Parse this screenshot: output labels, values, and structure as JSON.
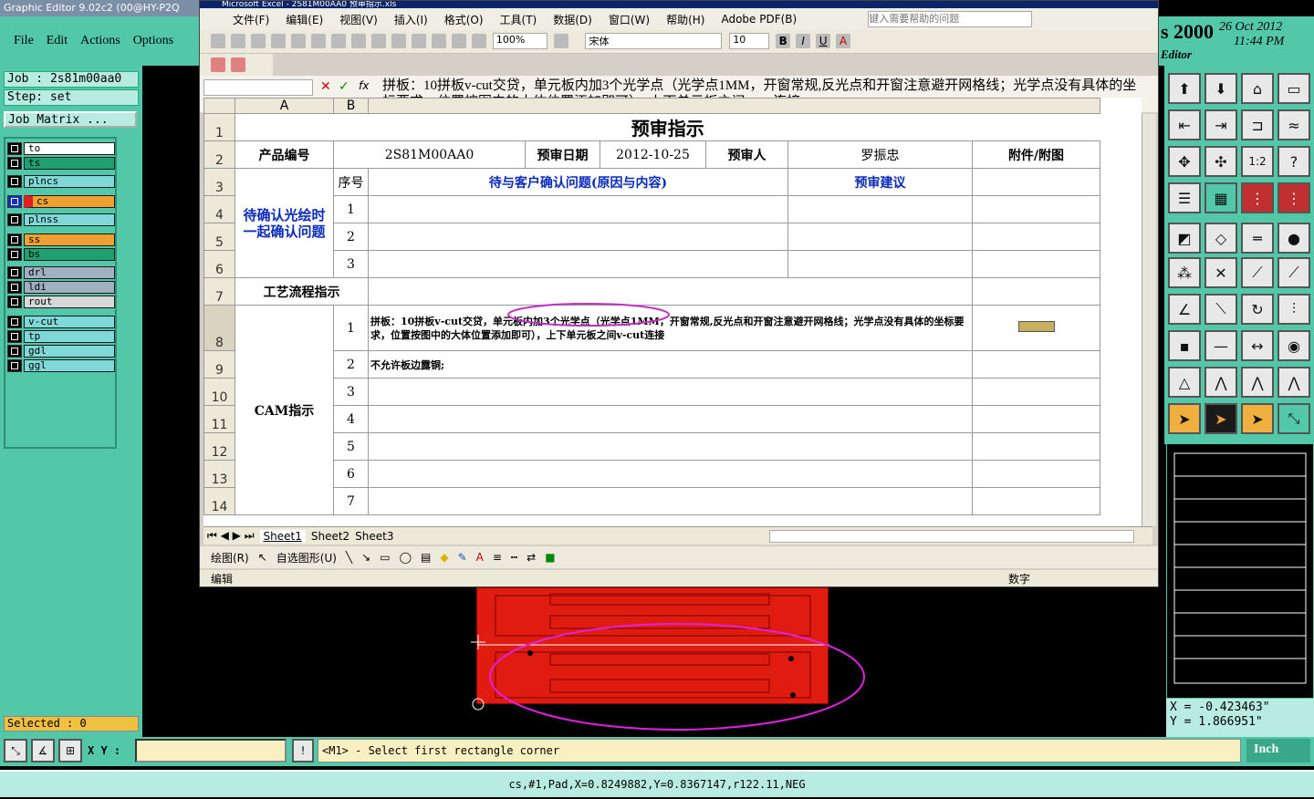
{
  "genesis": {
    "title": "Graphic Editor 9.02c2 (00@HY-P2Q",
    "menu": [
      "File",
      "Edit",
      "Actions",
      "Options"
    ],
    "job": "Job : 2s81m00aa0",
    "step": "Step: set",
    "job_matrix": "Job Matrix ...",
    "layers": [
      {
        "name": "to",
        "color": "#ffffff"
      },
      {
        "name": "ts",
        "color": "#20a070"
      },
      {
        "name": "plncs",
        "color": "#80d8d8"
      },
      {
        "name": "cs",
        "color": "#f0a030"
      },
      {
        "name": "plnss",
        "color": "#80d8d8"
      },
      {
        "name": "ss",
        "color": "#f0a030"
      },
      {
        "name": "bs",
        "color": "#20a070"
      },
      {
        "name": "drl",
        "color": "#a0b0c0"
      },
      {
        "name": "ldi",
        "color": "#a0b0c0"
      },
      {
        "name": "rout",
        "color": "#d8d8d8"
      },
      {
        "name": "v-cut",
        "color": "#80d8d8"
      },
      {
        "name": "tp",
        "color": "#80d8d8"
      },
      {
        "name": "gdl",
        "color": "#80d8d8"
      },
      {
        "name": "ggl",
        "color": "#80d8d8"
      }
    ],
    "selected": "Selected : 0",
    "clock_year": "s 2000",
    "clock_date": "26 Oct 2012",
    "clock_time": "11:44 PM",
    "clock_label": "Editor",
    "coord_x": "X = -0.423463\"",
    "coord_y": "Y = 1.866951\"",
    "xy_label": "X Y :",
    "prompt": "<M1> - Select first rectangle corner",
    "units": "Inch",
    "status": "cs,#1,Pad,X=0.8249882,Y=0.8367147,r122.11,NEG"
  },
  "excel": {
    "title": "Microsoft Excel - 2S81M00AA0 预审指示.xls",
    "menu": [
      "文件(F)",
      "编辑(E)",
      "视图(V)",
      "插入(I)",
      "格式(O)",
      "工具(T)",
      "数据(D)",
      "窗口(W)",
      "帮助(H)",
      "Adobe PDF(B)"
    ],
    "help_placeholder": "键入需要帮助的问题",
    "zoom": "100%",
    "font_name": "宋体",
    "font_size": "10",
    "formula_text": "拼板：10拼板v-cut交贷，单元板内加3个光学点（光学点1MM，开窗常规,反光点和开窗注意避开网格线；光学点没有具体的坐标要求，位置按图中的大体位置添加即可），上下单元板之间v-cut连接",
    "col_a": "A",
    "col_b": "B",
    "sheet_title": "预审指示",
    "product_label": "产品编号",
    "product_no": "2S81M00AA0",
    "date_label": "预审日期",
    "date": "2012-10-25",
    "reviewer_label": "预审人",
    "reviewer": "罗振忠",
    "attach_label": "附件/附图",
    "confirm_label": "待确认光绘时一起确认问题",
    "seq_label": "序号",
    "issue_label": "待与客户确认问题(原因与内容)",
    "advice_label": "预审建议",
    "process_label": "工艺流程指示",
    "cam_label": "CAM指示",
    "cam_row1": "拼板：10拼板v-cut交贷，单元板内加3个光学点（光学点1MM，开窗常规,反光点和开窗注意避开网格线；光学点没有具体的坐标要求，位置按图中的大体位置添加即可），上下单元板之间v-cut连接",
    "cam_row2": "不允许板边露铜;",
    "sheets": [
      "Sheet1",
      "Sheet2",
      "Sheet3"
    ],
    "draw_label": "绘图(R)",
    "autoshape_label": "自选图形(U)",
    "status_left": "编辑",
    "status_right": "数字"
  }
}
